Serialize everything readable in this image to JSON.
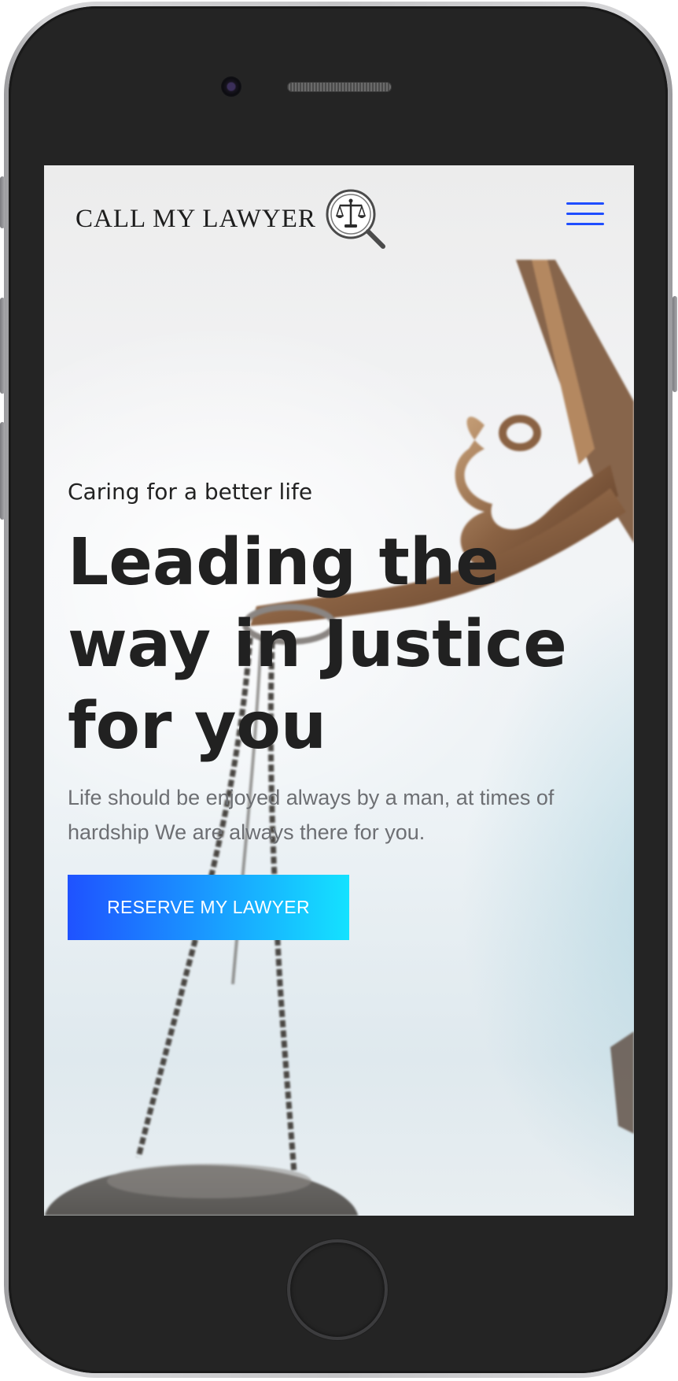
{
  "header": {
    "logo_text": "CALL MY LAWYER",
    "logo_icon": "scales-magnifier-icon",
    "menu_icon": "hamburger-menu-icon"
  },
  "hero": {
    "eyebrow": "Caring for a better life",
    "headline": "Leading the way in Justice for you",
    "subtext": "Life should be enjoyed always by a man, at times of hardship We are always there for you.",
    "cta_label": "RESERVE MY LAWYER"
  },
  "colors": {
    "accent": "#1f4dff",
    "cta_gradient_start": "#1f52ff",
    "cta_gradient_end": "#14e2ff",
    "heading": "#212121",
    "body_text": "#6d6f73",
    "device_frame": "#242424"
  }
}
